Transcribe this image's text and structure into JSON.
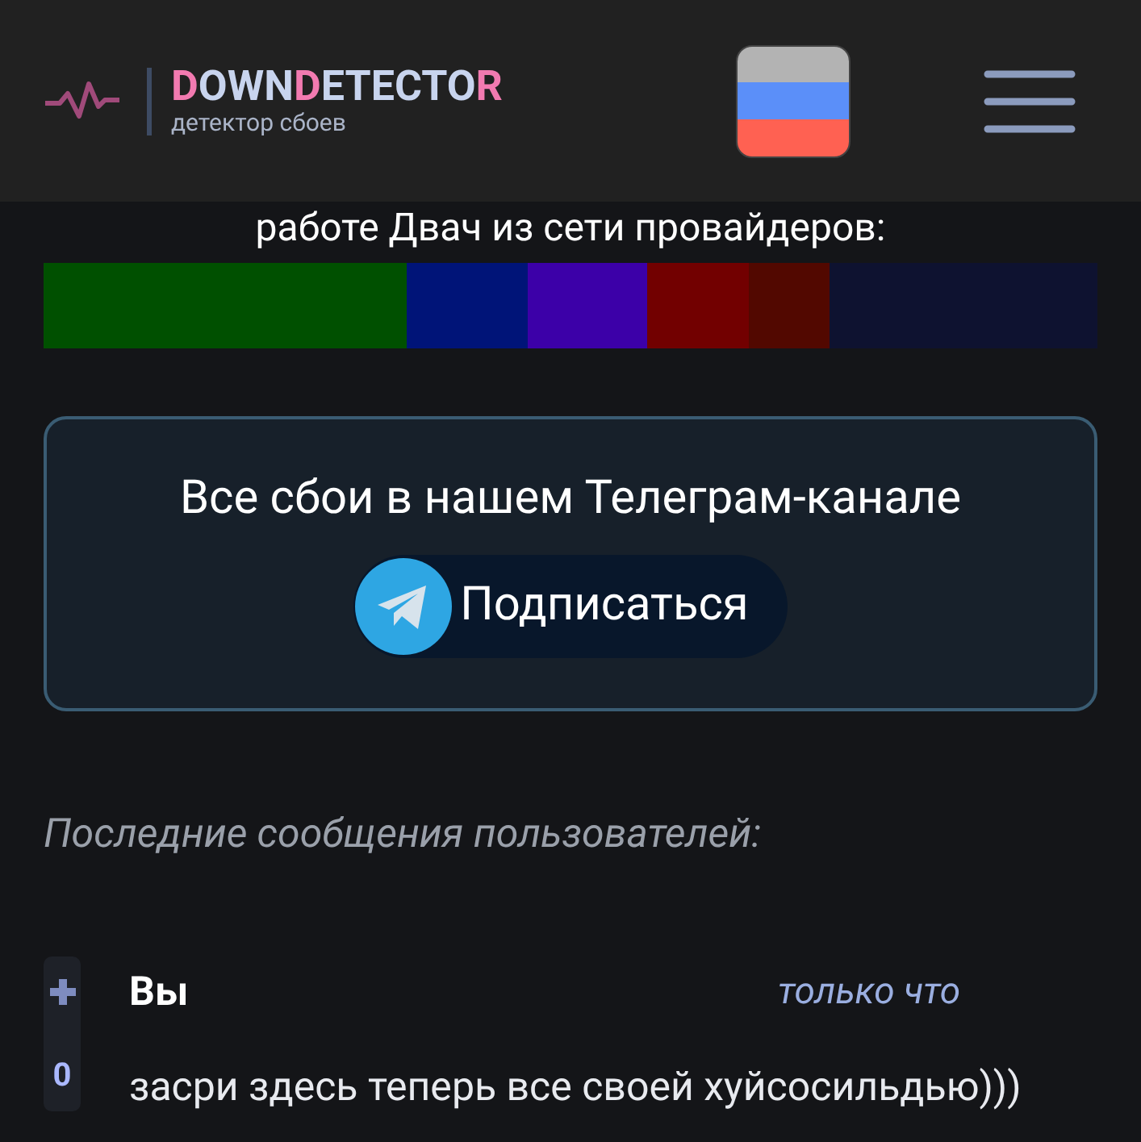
{
  "header": {
    "logo": {
      "parts": [
        {
          "text": "D",
          "accent": true
        },
        {
          "text": "OWN",
          "accent": false
        },
        {
          "text": "D",
          "accent": true
        },
        {
          "text": "ETECTO",
          "accent": false
        },
        {
          "text": "R",
          "accent": true
        }
      ],
      "tagline": "детектор сбоев"
    }
  },
  "intro_text": "работе Двач из сети провайдеров:",
  "segments": [
    {
      "color": "#005000"
    },
    {
      "color": "#001478"
    },
    {
      "color": "#3c00a8"
    },
    {
      "color": "#720000"
    },
    {
      "color": "#520800"
    },
    {
      "color": "#0e1230"
    }
  ],
  "telegram_card": {
    "title": "Все сбои в нашем Телеграм-канале",
    "button": "Подписаться"
  },
  "messages_heading": "Последние сообщения пользователей:",
  "messages": [
    {
      "author": "Вы",
      "time": "только что",
      "score": "0",
      "text": "засри здесь теперь все своей хуйсосильдью)))"
    }
  ]
}
